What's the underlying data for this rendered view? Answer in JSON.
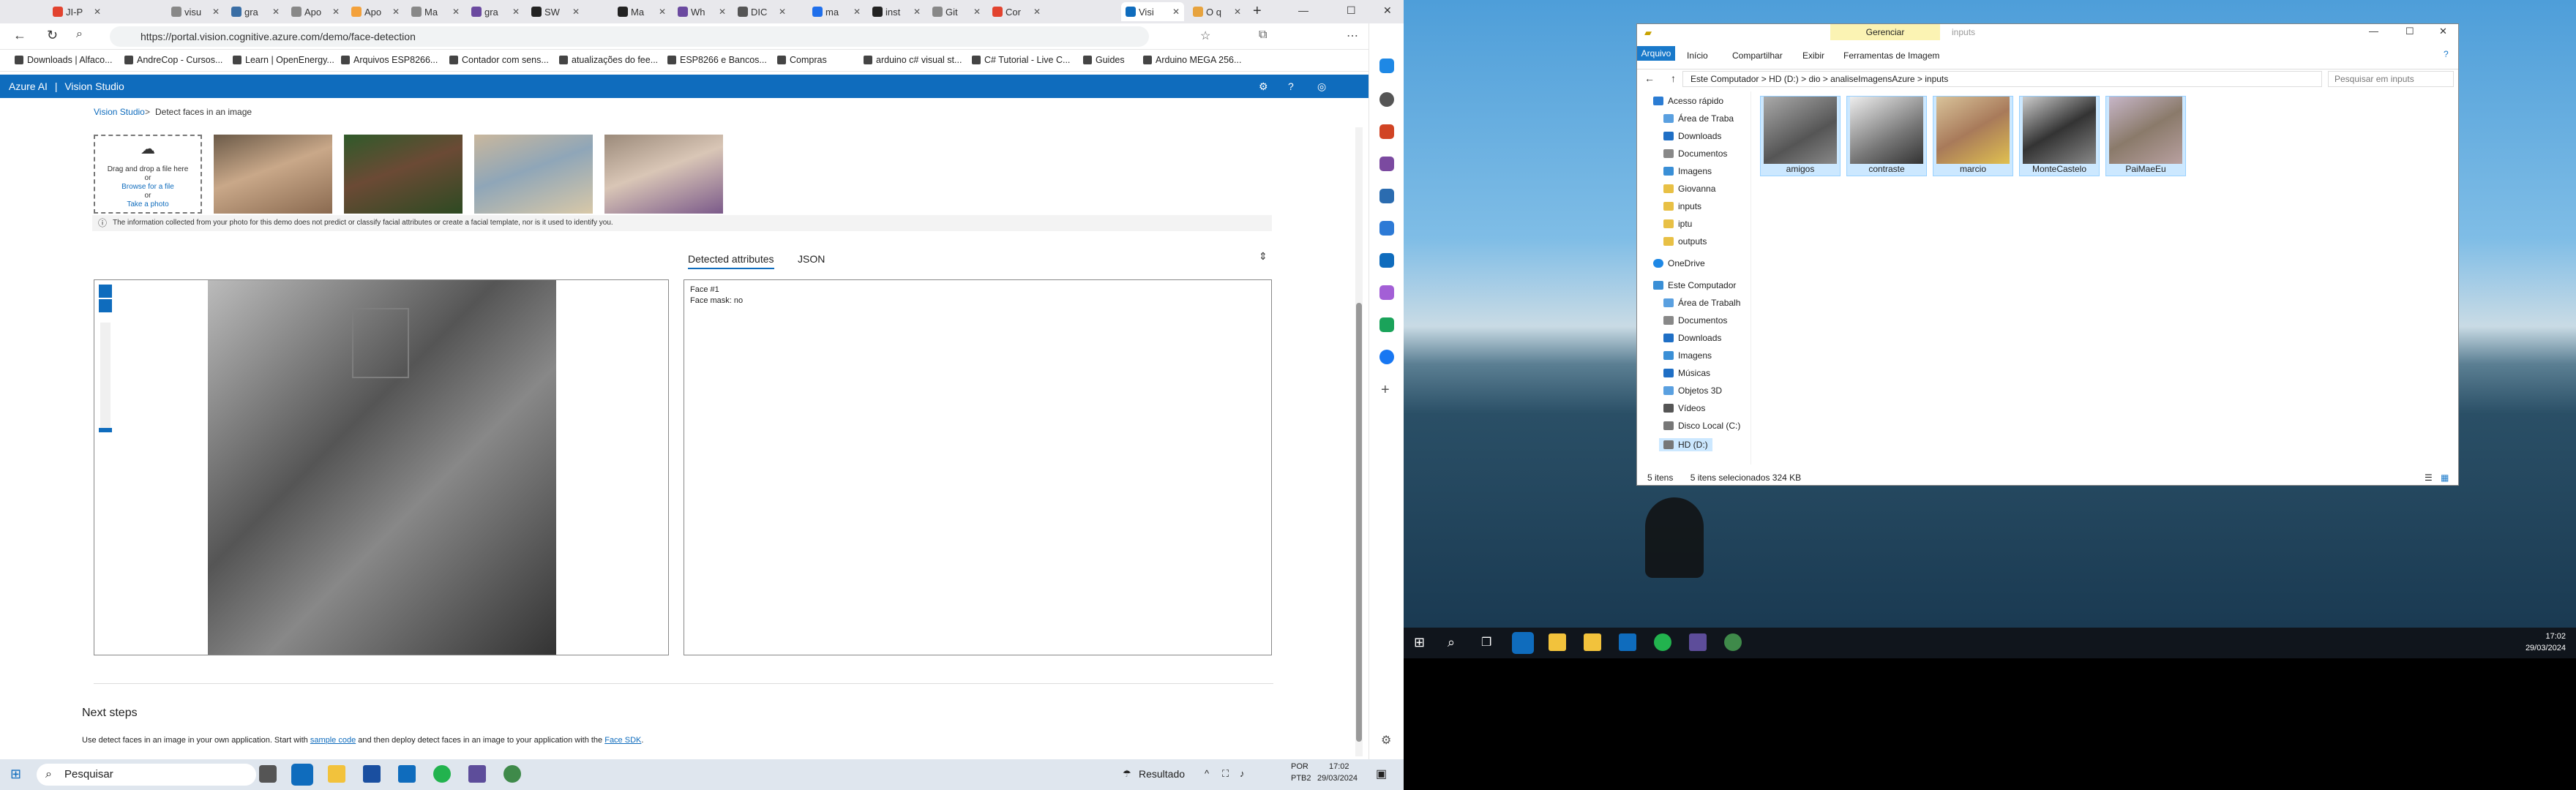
{
  "browser": {
    "tabs": [
      "JI-P",
      "visu",
      "gra",
      "Apo",
      "Apo",
      "Ma",
      "gra",
      "SW",
      "Ma",
      "Wh",
      "DIC",
      "ma",
      "inst",
      "Git",
      "Cor",
      "Visi",
      "O q"
    ],
    "url": "https://portal.vision.cognitive.azure.com/demo/face-detection",
    "bookmarks": [
      "Downloads | Alfaco...",
      "AndreCop - Cursos...",
      "Learn | OpenEnergy...",
      "Arquivos ESP8266...",
      "Contador com sens...",
      "atualizações do fee...",
      "ESP8266 e Bancos...",
      "Compras",
      "arduino c# visual st...",
      "C# Tutorial - Live C...",
      "Guides",
      "Arduino MEGA 256..."
    ]
  },
  "azure": {
    "brand": "Azure AI",
    "product": "Vision Studio"
  },
  "page": {
    "crumb_home": "Vision Studio",
    "crumb_sep": ">",
    "crumb_current": "Detect faces in an image",
    "drop_line1": "Drag and drop a file here",
    "drop_or1": "or",
    "drop_browse": "Browse for a file",
    "drop_or2": "or",
    "drop_photo": "Take a photo",
    "info": "The information collected from your photo for this demo does not predict or classify facial attributes or create a facial template, nor is it used to identify you.",
    "tab_detected": "Detected attributes",
    "tab_json": "JSON",
    "face_label": "Face #1",
    "face_mask": "Face mask: no",
    "next_steps": "Next steps",
    "use_text_pre": "Use detect faces in an image in your own application. Start with ",
    "use_link1": "sample code",
    "use_text_mid": " and then deploy detect faces in an image to your application with the ",
    "use_link2": "Face SDK",
    "use_text_post": "."
  },
  "taskbar_left": {
    "search": "Pesquisar",
    "resultado": "Resultado",
    "lang1": "POR",
    "lang2": "PTB2",
    "time": "17:02",
    "date": "29/03/2024"
  },
  "explorer": {
    "title": "inputs",
    "manage": "Gerenciar",
    "ribbon_tabs": [
      "Arquivo",
      "Início",
      "Compartilhar",
      "Exibir",
      "Ferramentas de Imagem"
    ],
    "path": [
      "Este Computador",
      "HD (D:)",
      "dio",
      "analiseImagensAzure",
      "inputs"
    ],
    "search": "Pesquisar em inputs",
    "nav": [
      "Acesso rápido",
      "Área de Traba",
      "Downloads",
      "Documentos",
      "Imagens",
      "Giovanna",
      "inputs",
      "iptu",
      "outputs",
      "OneDrive",
      "Este Computador",
      "Área de Trabalh",
      "Documentos",
      "Downloads",
      "Imagens",
      "Músicas",
      "Objetos 3D",
      "Vídeos",
      "Disco Local (C:)",
      "HD (D:)"
    ],
    "files": [
      "amigos",
      "contraste",
      "marcio",
      "MonteCastelo",
      "PaiMaeEu"
    ],
    "status_items": "5 itens",
    "status_sel": "5 itens selecionados  324 KB"
  },
  "taskbar_right": {
    "time": "17:02",
    "date": "29/03/2024"
  },
  "colors": {
    "azure_blue": "#0f6cbd",
    "face_box": "#4a86c5"
  }
}
